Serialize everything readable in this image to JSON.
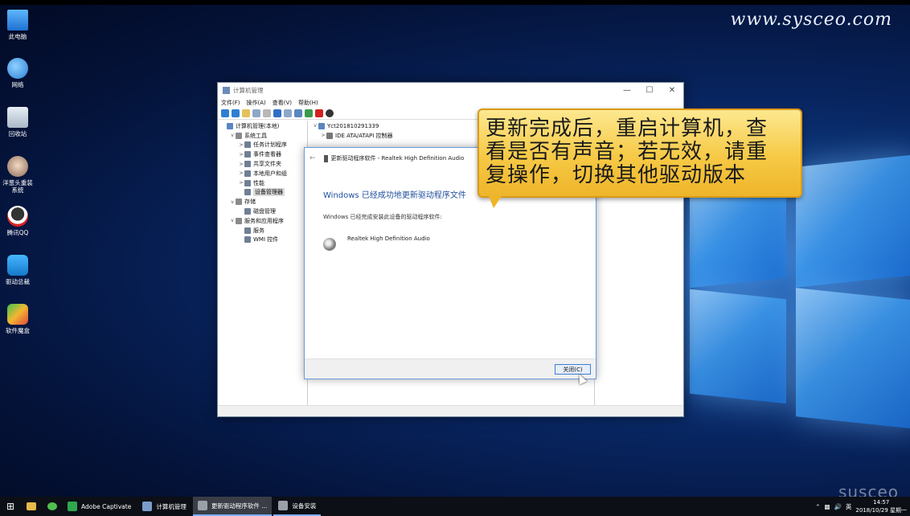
{
  "watermark": "www.sysceo.com",
  "watermark_bottom": "susceo",
  "desktop_icons": [
    {
      "label": "此电脑",
      "icon": "this-pc-icon"
    },
    {
      "label": "网络",
      "icon": "network-icon"
    },
    {
      "label": "回收站",
      "icon": "recycle-bin-icon"
    },
    {
      "label": "洋葱头重装系统",
      "icon": "reinstall-icon"
    },
    {
      "label": "腾讯QQ",
      "icon": "qq-icon"
    },
    {
      "label": "驱动总裁",
      "icon": "driver-icon"
    },
    {
      "label": "软件魔盒",
      "icon": "software-box-icon"
    }
  ],
  "computer_management": {
    "title": "计算机管理",
    "menu": [
      "文件(F)",
      "操作(A)",
      "查看(V)",
      "帮助(H)"
    ],
    "tree": [
      {
        "label": "计算机管理(本地)",
        "indent": 0,
        "twisty": ""
      },
      {
        "label": "系统工具",
        "indent": 1,
        "twisty": "v"
      },
      {
        "label": "任务计划程序",
        "indent": 2,
        "twisty": ">"
      },
      {
        "label": "事件查看器",
        "indent": 2,
        "twisty": ">"
      },
      {
        "label": "共享文件夹",
        "indent": 2,
        "twisty": ">"
      },
      {
        "label": "本地用户和组",
        "indent": 2,
        "twisty": ">"
      },
      {
        "label": "性能",
        "indent": 2,
        "twisty": ">"
      },
      {
        "label": "设备管理器",
        "indent": 2,
        "twisty": "",
        "selected": true
      },
      {
        "label": "存储",
        "indent": 1,
        "twisty": "v"
      },
      {
        "label": "磁盘管理",
        "indent": 2,
        "twisty": ""
      },
      {
        "label": "服务和应用程序",
        "indent": 1,
        "twisty": "v"
      },
      {
        "label": "服务",
        "indent": 2,
        "twisty": ""
      },
      {
        "label": "WMI 控件",
        "indent": 2,
        "twisty": ""
      }
    ],
    "device_tree": [
      {
        "label": "Yct201810291339",
        "twisty": "v"
      },
      {
        "label": "IDE ATA/ATAPI 控制器",
        "twisty": ">"
      }
    ]
  },
  "dialog": {
    "title": "更新驱动程序软件 - Realtek High Definition Audio",
    "heading": "Windows 已经成功地更新驱动程序文件",
    "subtext": "Windows 已经完成安装此设备的驱动程序软件:",
    "device_name": "Realtek High Definition Audio",
    "close_button": "关闭(C)"
  },
  "callout": {
    "lines": [
      "更新完成后，重启计算机，查",
      "看是否有声音；若无效，请重",
      "复操作，切换其他驱动版本"
    ]
  },
  "taskbar": {
    "apps": [
      {
        "label": "Adobe Captivate",
        "state": "normal",
        "color": "#2fa84f"
      },
      {
        "label": "计算机管理",
        "state": "normal",
        "color": "#7a9ccc"
      },
      {
        "label": "更新驱动程序软件 ...",
        "state": "active",
        "color": "#9aa0a8"
      },
      {
        "label": "设备安装",
        "state": "open",
        "color": "#9aa0a8"
      }
    ],
    "ime": "英",
    "time": "14:57",
    "date": "2018/10/29 星期一"
  }
}
